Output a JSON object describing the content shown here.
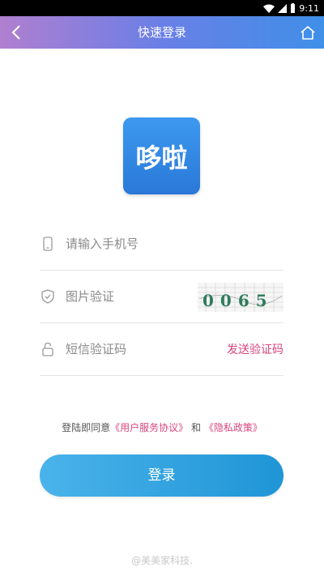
{
  "status_bar": {
    "time": "9:11"
  },
  "nav": {
    "title": "快速登录",
    "back_icon": "chevron-left-icon",
    "home_icon": "home-icon"
  },
  "logo": {
    "text": "哆啦"
  },
  "form": {
    "phone": {
      "placeholder": "请输入手机号",
      "value": "",
      "icon": "phone-icon"
    },
    "captcha": {
      "placeholder": "图片验证",
      "value": "",
      "icon": "shield-icon",
      "image_text": "0065"
    },
    "sms": {
      "placeholder": "短信验证码",
      "value": "",
      "icon": "lock-icon",
      "send_label": "发送验证码"
    }
  },
  "agreement": {
    "prefix": "登陆即同意",
    "terms_link": "《用户服务协议》",
    "conjunction": "和",
    "privacy_link": "《隐私政策》"
  },
  "login_button": {
    "label": "登录"
  },
  "footer": {
    "text": "@美美家科技."
  },
  "colors": {
    "accent": "#d8467c",
    "button": "#2fa3e0",
    "nav_start": "#b07fd0",
    "nav_end": "#3f8fe8"
  }
}
